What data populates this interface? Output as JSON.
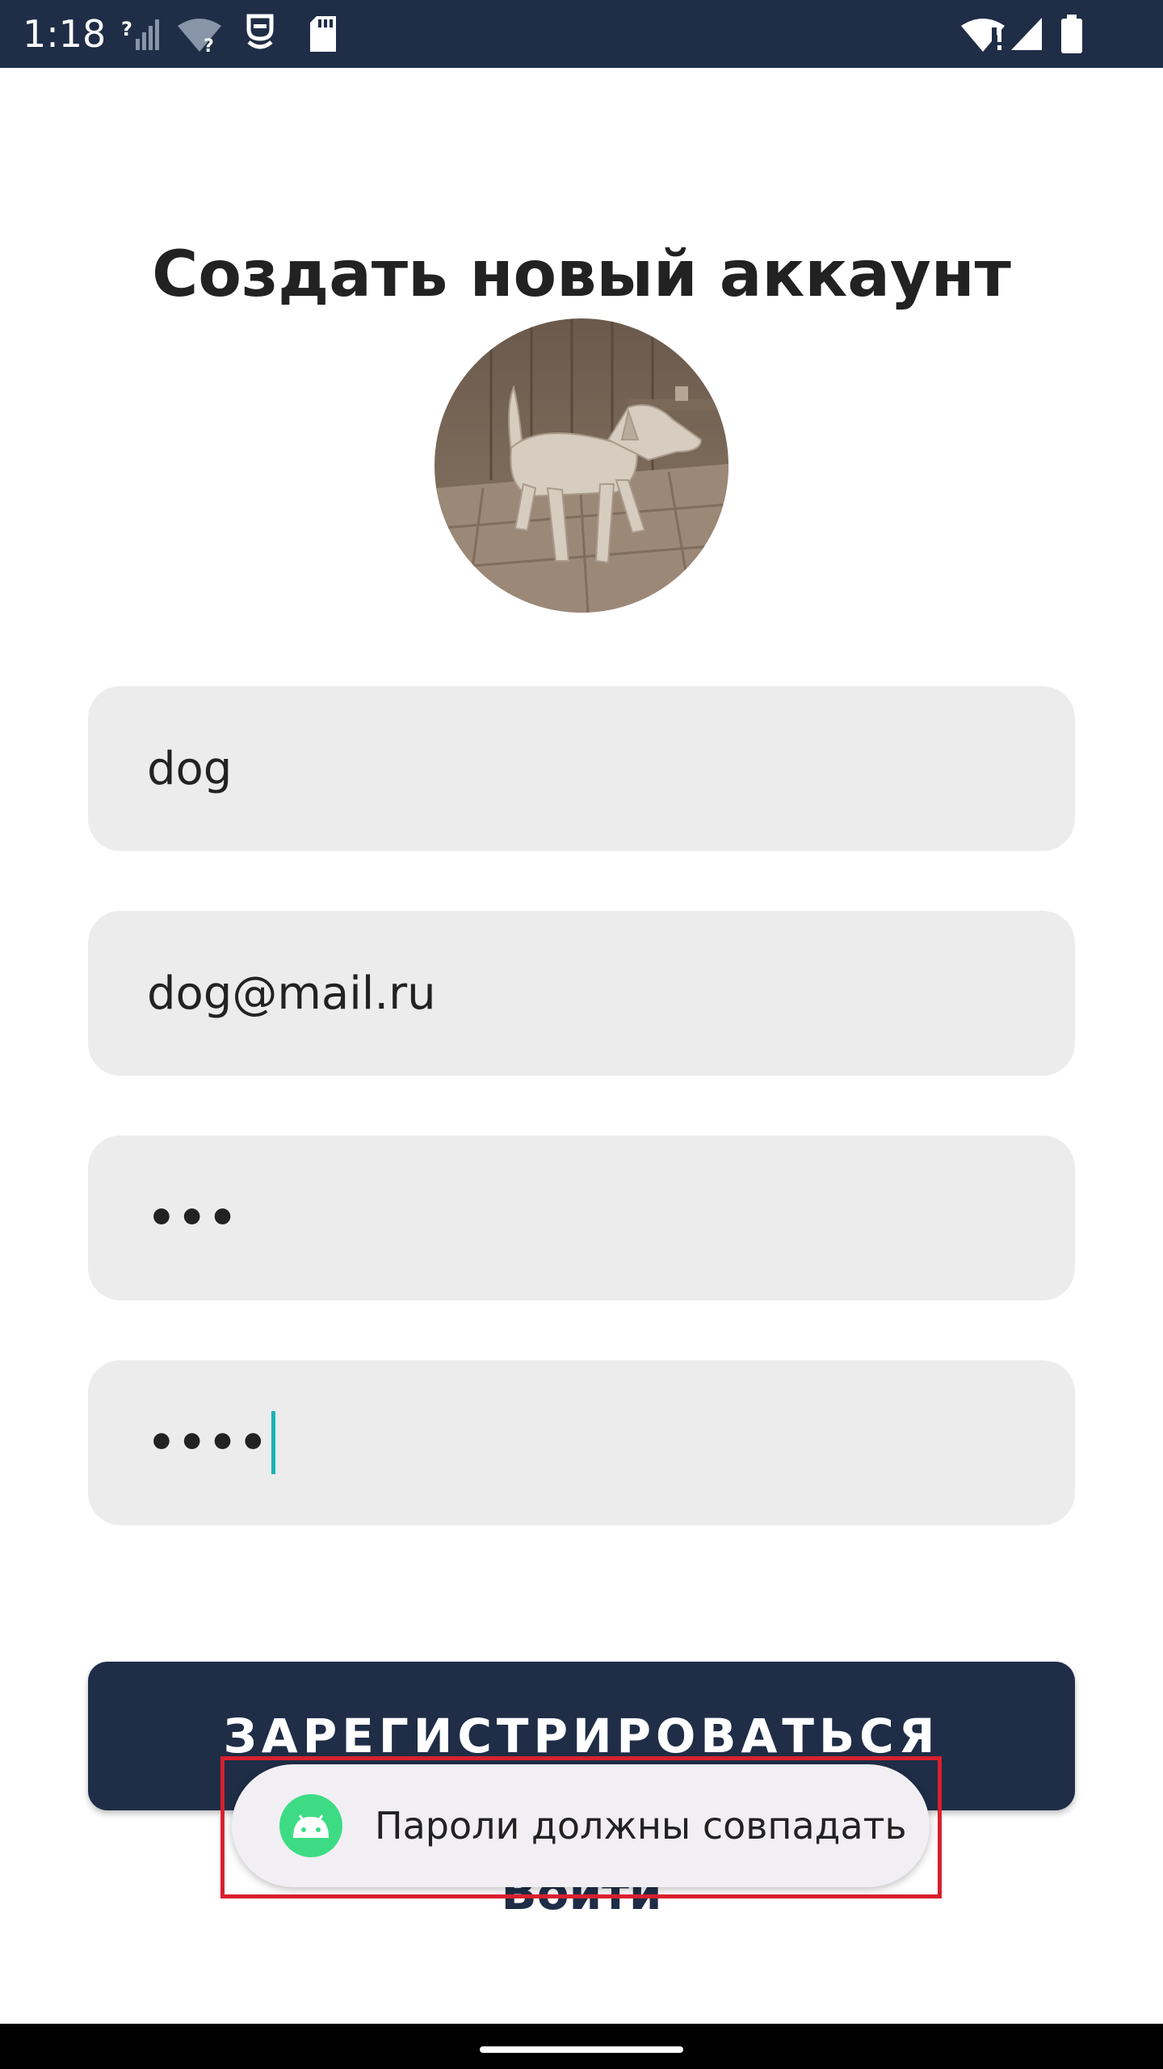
{
  "status_bar": {
    "time": "1:18",
    "icons": [
      "signal-unknown-icon",
      "wifi-unknown-icon",
      "sim-icon",
      "sd-card-icon",
      "wifi-alert-icon",
      "cell-signal-icon",
      "battery-icon"
    ]
  },
  "form": {
    "title": "Создать новый аккаунт",
    "username_value": "dog",
    "email_value": "dog@mail.ru",
    "password_value": "•••",
    "confirm_password_value": "••••",
    "register_label": "ЗАРЕГИСТРИРОВАТЬСЯ",
    "login_label": "Войти"
  },
  "toast": {
    "message": "Пароли должны совпадать"
  },
  "colors": {
    "primary": "#1f2d47",
    "field_bg": "#ececec",
    "toast_bg": "#f1eff3",
    "highlight": "#d9202e",
    "android_green": "#3ddc84"
  }
}
